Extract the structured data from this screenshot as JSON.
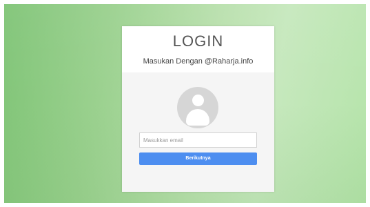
{
  "login": {
    "title": "LOGIN",
    "subtitle": "Masukan Dengan @Raharja.info",
    "avatar_icon": "user-avatar-icon",
    "email_input": {
      "placeholder": "Masukkan email",
      "value": ""
    },
    "next_button_label": "Berikutnya"
  },
  "colors": {
    "background_green_left": "#7fc476",
    "background_green_right": "#c6e8bd",
    "button_blue": "#4d8ef0",
    "card_background": "#f5f5f5"
  }
}
